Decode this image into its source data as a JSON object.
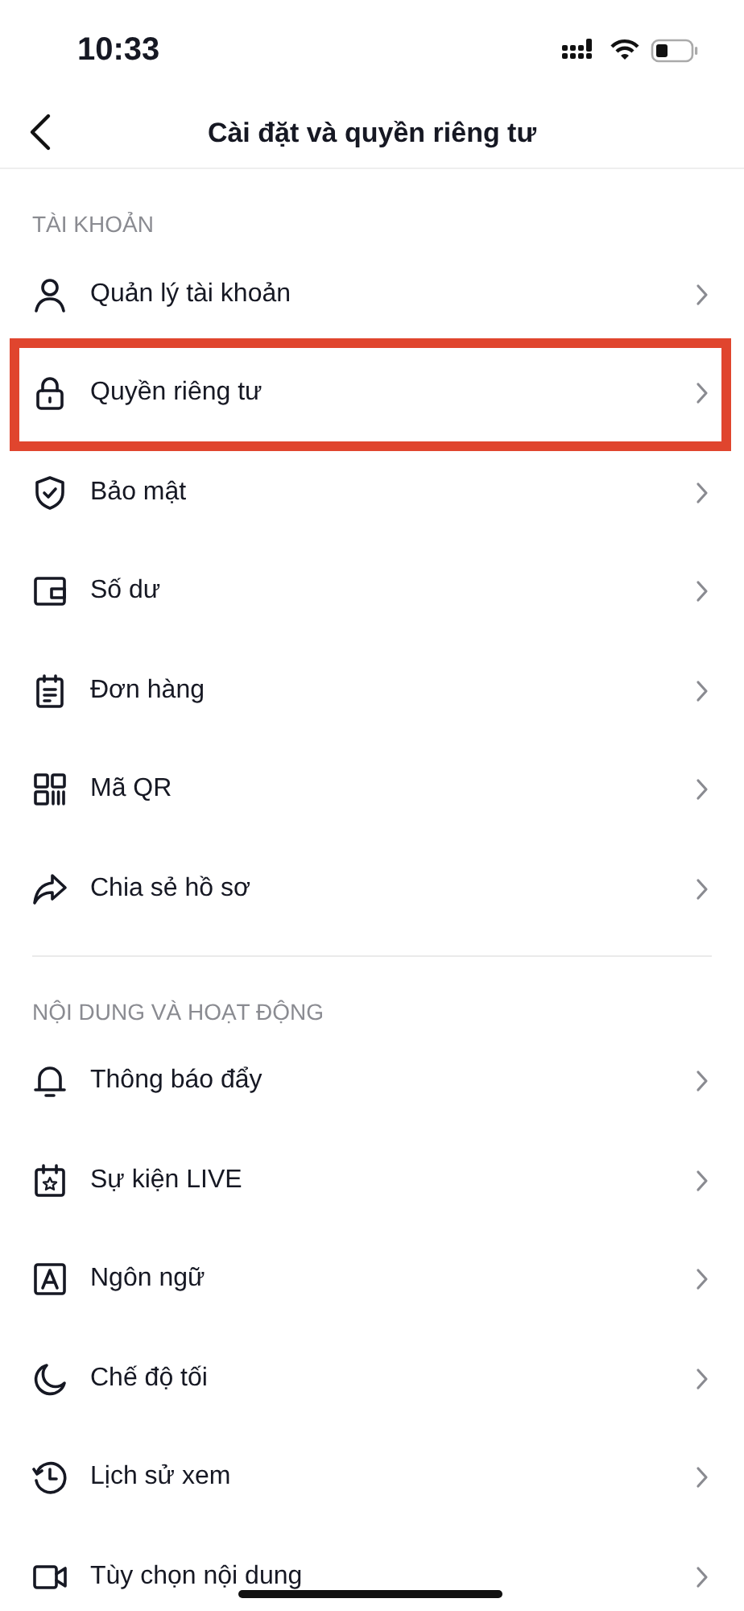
{
  "status_bar": {
    "time": "10:33"
  },
  "header": {
    "title": "Cài đặt và quyền riêng tư"
  },
  "sections": [
    {
      "title": "TÀI KHOẢN",
      "items": [
        {
          "label": "Quản lý tài khoản",
          "highlighted": false
        },
        {
          "label": "Quyền riêng tư",
          "highlighted": true
        },
        {
          "label": "Bảo mật",
          "highlighted": false
        },
        {
          "label": "Số dư",
          "highlighted": false
        },
        {
          "label": "Đơn hàng",
          "highlighted": false
        },
        {
          "label": "Mã QR",
          "highlighted": false
        },
        {
          "label": "Chia sẻ hồ sơ",
          "highlighted": false
        }
      ]
    },
    {
      "title": "NỘI DUNG VÀ HOẠT ĐỘNG",
      "items": [
        {
          "label": "Thông báo đẩy",
          "highlighted": false
        },
        {
          "label": "Sự kiện LIVE",
          "highlighted": false
        },
        {
          "label": "Ngôn ngữ",
          "highlighted": false
        },
        {
          "label": "Chế độ tối",
          "highlighted": false
        },
        {
          "label": "Lịch sử xem",
          "highlighted": false
        },
        {
          "label": "Tùy chọn nội dung",
          "highlighted": false
        }
      ]
    }
  ]
}
